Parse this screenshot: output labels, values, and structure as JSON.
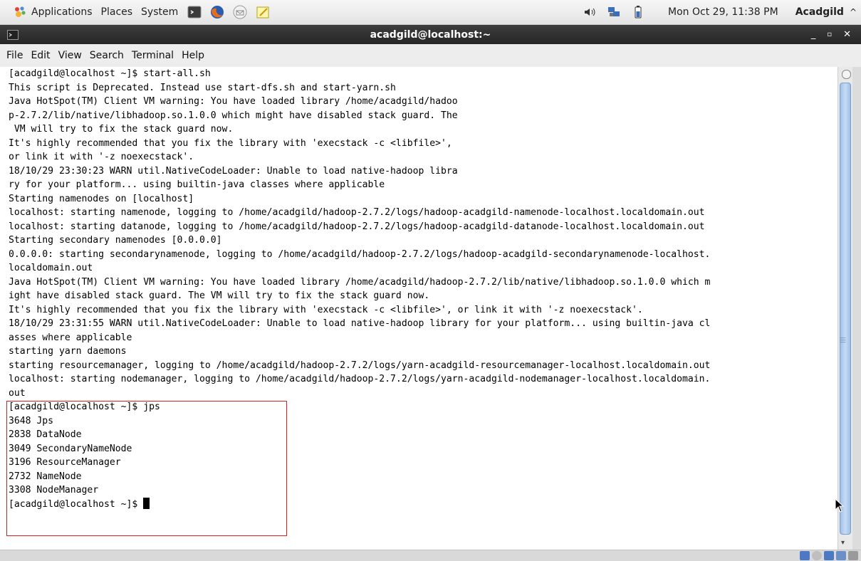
{
  "panel": {
    "menus": [
      "Applications",
      "Places",
      "System"
    ],
    "clock": "Mon Oct 29, 11:38 PM",
    "user": "Acadgild"
  },
  "window": {
    "title": "acadgild@localhost:~"
  },
  "menubar": {
    "items": [
      "File",
      "Edit",
      "View",
      "Search",
      "Terminal",
      "Help"
    ]
  },
  "terminal": {
    "lines": [
      "[acadgild@localhost ~]$ start-all.sh",
      "This script is Deprecated. Instead use start-dfs.sh and start-yarn.sh",
      "Java HotSpot(TM) Client VM warning: You have loaded library /home/acadgild/hadoo",
      "p-2.7.2/lib/native/libhadoop.so.1.0.0 which might have disabled stack guard. The",
      " VM will try to fix the stack guard now.",
      "It's highly recommended that you fix the library with 'execstack -c <libfile>',",
      "or link it with '-z noexecstack'.",
      "18/10/29 23:30:23 WARN util.NativeCodeLoader: Unable to load native-hadoop libra",
      "ry for your platform... using builtin-java classes where applicable",
      "Starting namenodes on [localhost]",
      "localhost: starting namenode, logging to /home/acadgild/hadoop-2.7.2/logs/hadoop-acadgild-namenode-localhost.localdomain.out",
      "localhost: starting datanode, logging to /home/acadgild/hadoop-2.7.2/logs/hadoop-acadgild-datanode-localhost.localdomain.out",
      "Starting secondary namenodes [0.0.0.0]",
      "0.0.0.0: starting secondarynamenode, logging to /home/acadgild/hadoop-2.7.2/logs/hadoop-acadgild-secondarynamenode-localhost.",
      "localdomain.out",
      "Java HotSpot(TM) Client VM warning: You have loaded library /home/acadgild/hadoop-2.7.2/lib/native/libhadoop.so.1.0.0 which m",
      "ight have disabled stack guard. The VM will try to fix the stack guard now.",
      "It's highly recommended that you fix the library with 'execstack -c <libfile>', or link it with '-z noexecstack'.",
      "18/10/29 23:31:55 WARN util.NativeCodeLoader: Unable to load native-hadoop library for your platform... using builtin-java cl",
      "asses where applicable",
      "starting yarn daemons",
      "starting resourcemanager, logging to /home/acadgild/hadoop-2.7.2/logs/yarn-acadgild-resourcemanager-localhost.localdomain.out",
      "localhost: starting nodemanager, logging to /home/acadgild/hadoop-2.7.2/logs/yarn-acadgild-nodemanager-localhost.localdomain.",
      "out",
      "[acadgild@localhost ~]$ jps",
      "3648 Jps",
      "2838 DataNode",
      "3049 SecondaryNameNode",
      "3196 ResourceManager",
      "2732 NameNode",
      "3308 NodeManager"
    ],
    "prompt": "[acadgild@localhost ~]$ "
  }
}
